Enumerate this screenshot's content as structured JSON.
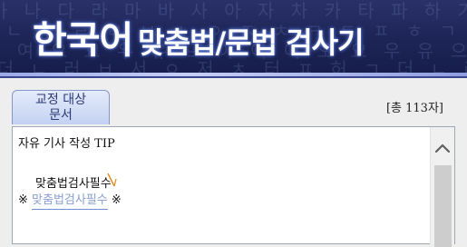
{
  "header": {
    "title_main": "한국어",
    "title_sub": "맞춤법/문법 검사기"
  },
  "tab": {
    "line1": "교정 대상",
    "line2": "문서"
  },
  "counter": {
    "prefix": "[총 ",
    "count": "113",
    "suffix": "자]"
  },
  "editor": {
    "line1_a": "자유 기사 작성 ",
    "line1_b": "TIP",
    "line2": "맞춤법검사필수",
    "line3_mark_left": "※ ",
    "line3_highlight": "맞춤법검사필수",
    "line3_mark_right": " ※"
  },
  "colors": {
    "banner": "#1e2659",
    "tab_fill": "#c4d1f1",
    "highlight": "#6f8fd5"
  }
}
